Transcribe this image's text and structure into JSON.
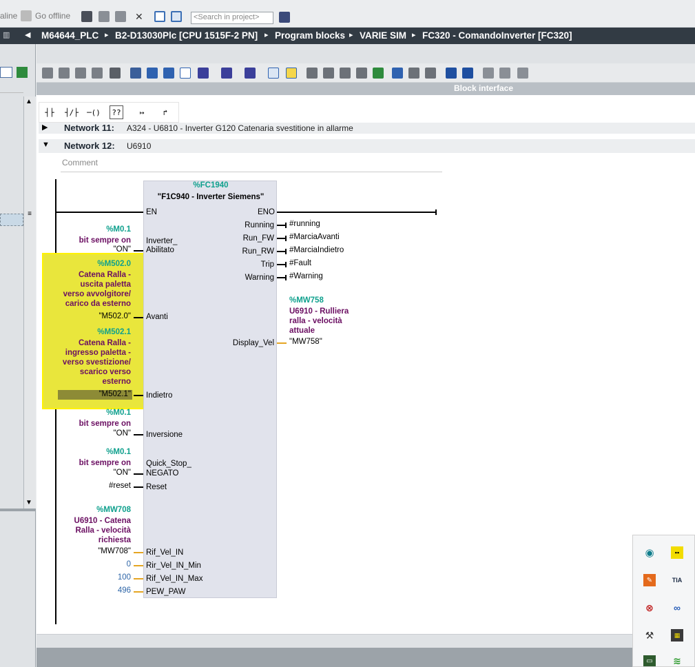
{
  "toolbar": {
    "online_label": "aline",
    "go_offline_label": "Go offline",
    "search_placeholder": "<Search in project>"
  },
  "breadcrumb": {
    "items": [
      "M64644_PLC",
      "B2-D13030Plc [CPU 1515F-2 PN]",
      "Program blocks",
      "VARIE SIM",
      "FC320 - ComandoInverter [FC320]"
    ],
    "separator": "▸"
  },
  "editor": {
    "block_interface_label": "Block interface",
    "network11": {
      "label": "Network 11:",
      "title": "A324 - U6810 - Inverter G120 Catenaria svestitione in allarme"
    },
    "network12": {
      "label": "Network 12:",
      "title": "U6910",
      "comment_placeholder": "Comment"
    }
  },
  "fbox": {
    "address": "%FC1940",
    "name": "\"F1C940 - Inverter Siemens\"",
    "inputs": [
      "EN",
      "Inverter_",
      "Abilitato",
      "Avanti",
      "Indietro",
      "Inversione",
      "Quick_Stop_",
      "NEGATO",
      "Reset",
      "Rif_Vel_IN",
      "Rir_Vel_IN_Min",
      "Rif_Vel_IN_Max",
      "PEW_PAW"
    ],
    "outputs": [
      "ENO",
      "Running",
      "Run_FW",
      "Run_RW",
      "Trip",
      "Warning",
      "Display_Vel"
    ]
  },
  "operands": {
    "m01a": {
      "addr": "%M0.1",
      "sym": "bit sempre on",
      "val": "\"ON\""
    },
    "m5020": {
      "addr": "%M502.0",
      "sym1": "Catena Ralla -",
      "sym2": "uscita paletta",
      "sym3": "verso avvolgitore/",
      "sym4": "carico da esterno",
      "val": "\"M502.0\""
    },
    "m5021": {
      "addr": "%M502.1",
      "sym1": "Catena Ralla -",
      "sym2": "ingresso paletta -",
      "sym3": "verso svestizione/",
      "sym4": "scarico verso",
      "sym5": "esterno",
      "val": "\"M502.1\""
    },
    "m01b": {
      "addr": "%M0.1",
      "sym": "bit sempre on",
      "val": "\"ON\""
    },
    "m01c": {
      "addr": "%M0.1",
      "sym": "bit sempre on",
      "val": "\"ON\""
    },
    "reset": "#reset",
    "mw708": {
      "addr": "%MW708",
      "sym1": "U6910 - Catena",
      "sym2": "Ralla - velocità",
      "sym3": "richiesta",
      "val": "\"MW708\""
    },
    "min": "0",
    "max": "100",
    "pew": "496",
    "out_running": "#running",
    "out_fw": "#MarciaAvanti",
    "out_rw": "#MarciaIndietro",
    "out_trip": "#Fault",
    "out_warn": "#Warning",
    "mw758": {
      "addr": "%MW758",
      "sym1": "U6910 - Rulliera",
      "sym2": "ralla - velocità",
      "sym3": "attuale",
      "val": "\"MW758\""
    }
  },
  "colors": {
    "address": "#0fa08d",
    "symbol": "#6b0f62",
    "highlight": "#e9e63c",
    "breadcrumb_bg": "#323b44"
  },
  "tray_icons": [
    "network-icon",
    "yellow-grid-icon",
    "editor-icon",
    "tia-portal-icon",
    "disconnect-icon",
    "link-icon",
    "tools-icon",
    "grid-app-icon",
    "terminal-icon",
    "wifi-icon"
  ]
}
